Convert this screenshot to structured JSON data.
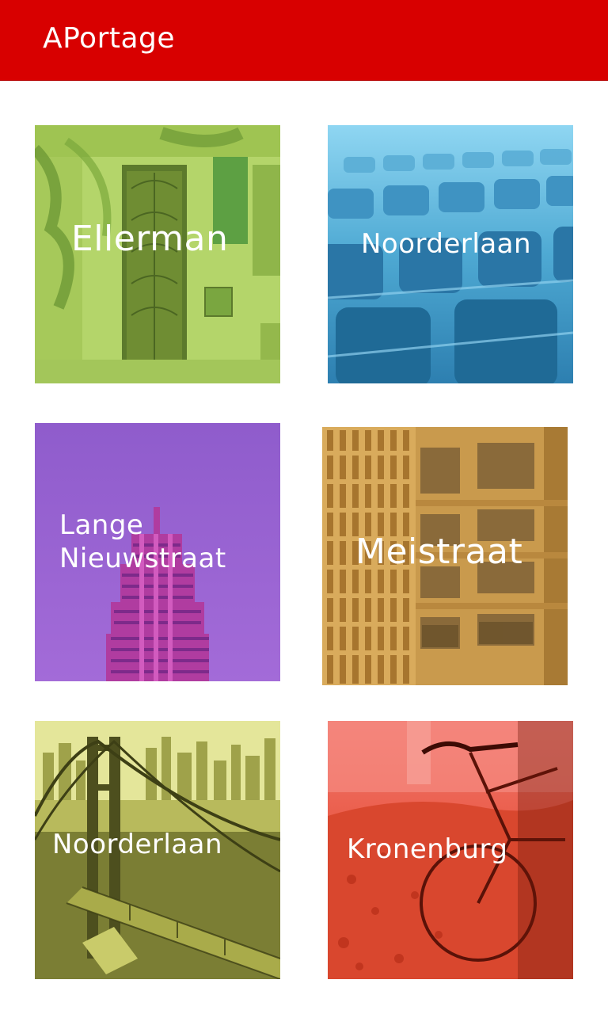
{
  "app": {
    "title": "APortage",
    "accent_color": "#d80000"
  },
  "tiles": [
    {
      "label": "Ellerman",
      "tint_color": "#8cc63f",
      "image": "building-doorway-photo"
    },
    {
      "label": "Noorderlaan",
      "tint_color": "#3aa7d9",
      "image": "auditorium-seats-photo"
    },
    {
      "label": "Lange\nNieuwstraat",
      "tint_color": "#9b5bd4",
      "image": "skyscraper-photo"
    },
    {
      "label": "Meistraat",
      "tint_color": "#d4a24a",
      "image": "office-facade-photo"
    },
    {
      "label": "Noorderlaan",
      "tint_color": "#c8cf4a",
      "image": "bay-bridge-photo"
    },
    {
      "label": "Kronenburg",
      "tint_color": "#e23b2e",
      "image": "bicycle-autumn-photo"
    }
  ]
}
